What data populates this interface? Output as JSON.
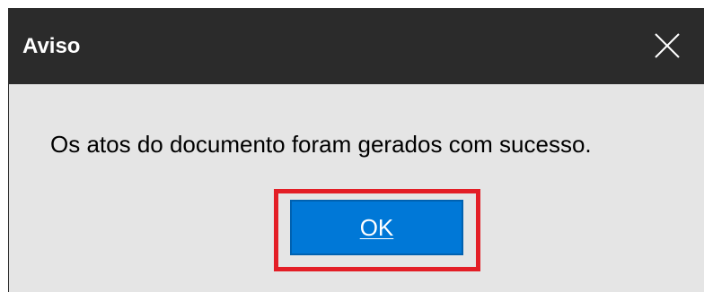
{
  "dialog": {
    "title": "Aviso",
    "close_icon": "close-icon",
    "message": "Os atos do documento foram gerados com sucesso.",
    "ok_label": "OK",
    "highlight_color": "#e31e26",
    "ok_button_color": "#0078d7",
    "titlebar_color": "#2b2b2b"
  }
}
